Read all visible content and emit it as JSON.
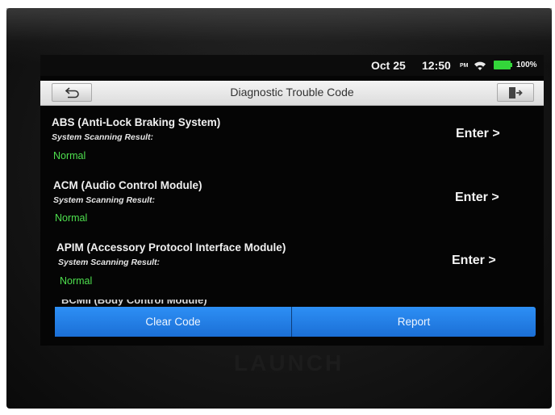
{
  "status_bar": {
    "date": "Oct 25",
    "time": "12:50",
    "ampm": "PM",
    "battery": "100%"
  },
  "header": {
    "title": "Diagnostic Trouble Code"
  },
  "systems": [
    {
      "name": "ABS (Anti-Lock Braking System)",
      "scan_label": "System Scanning Result:",
      "status": "Normal",
      "action": "Enter >"
    },
    {
      "name": "ACM (Audio Control Module)",
      "scan_label": "System Scanning Result:",
      "status": "Normal",
      "action": "Enter >"
    },
    {
      "name": "APIM (Accessory Protocol Interface Module)",
      "scan_label": "System Scanning Result:",
      "status": "Normal",
      "action": "Enter >"
    },
    {
      "name": "BCMII (Body Control Module)"
    }
  ],
  "buttons": {
    "clear_code": "Clear Code",
    "report": "Report"
  },
  "brand": "LAUNCH",
  "colors": {
    "status_normal": "#4ee04e",
    "button_blue": "#2d8ff5",
    "battery": "#33d63a"
  },
  "icons": {
    "back": "back-arrow-icon",
    "exit": "exit-icon",
    "wifi": "wifi-icon",
    "battery": "battery-icon"
  }
}
